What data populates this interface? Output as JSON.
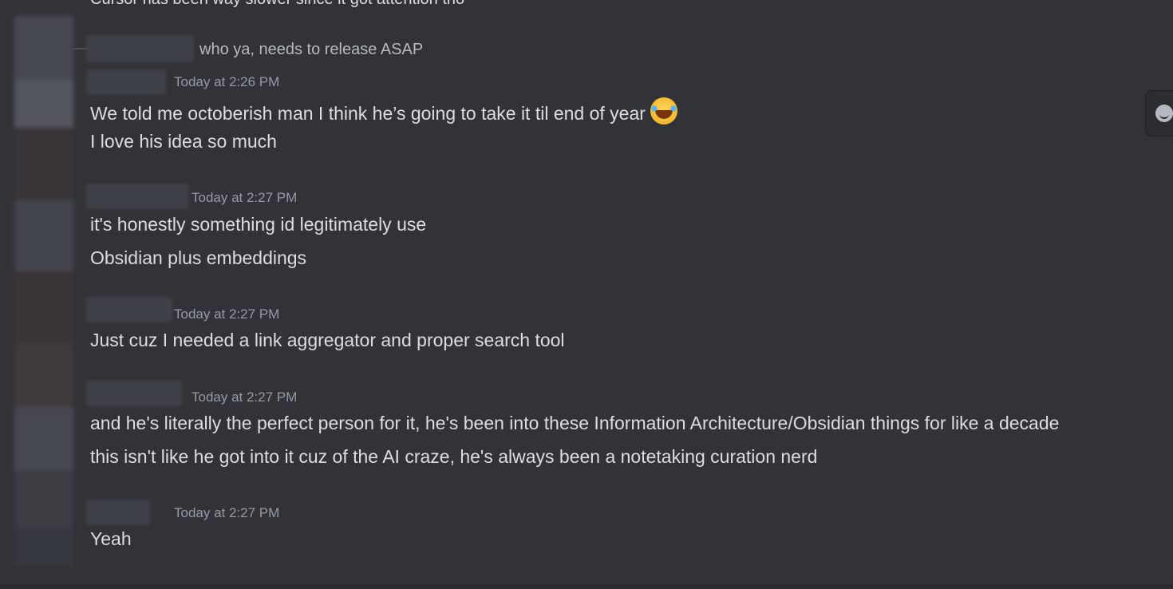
{
  "clipped_previous_message": "Cursor has been way slower since it got attention tho",
  "reply_preview": {
    "text": "who ya, needs to release ASAP"
  },
  "messages": [
    {
      "timestamp": "Today at 2:26 PM",
      "lines": [
        "We told me octoberish man I think he’s going to take it til end of year",
        "I love his idea so much"
      ],
      "emoji": "joy-emoji"
    },
    {
      "timestamp": "Today at 2:27 PM",
      "lines": [
        "it's honestly something id legitimately use",
        "Obsidian plus embeddings"
      ]
    },
    {
      "timestamp": "Today at 2:27 PM",
      "lines": [
        "Just cuz I needed a link aggregator and proper search tool"
      ]
    },
    {
      "timestamp": "Today at 2:27 PM",
      "lines": [
        "and he's literally the perfect person for it, he's been into these Information Architecture/Obsidian things for like a decade",
        "this isn't like he got into it cuz of the AI craze, he's always been a notetaking curation nerd"
      ]
    },
    {
      "timestamp": "Today at 2:27 PM",
      "lines": [
        "Yeah"
      ]
    }
  ],
  "icons": {
    "reaction": "add-reaction-icon",
    "emoji": "face-with-tears-of-joy-icon"
  },
  "colors": {
    "background": "#313338",
    "text": "#dbdee1",
    "timestamp": "#949ba4"
  }
}
